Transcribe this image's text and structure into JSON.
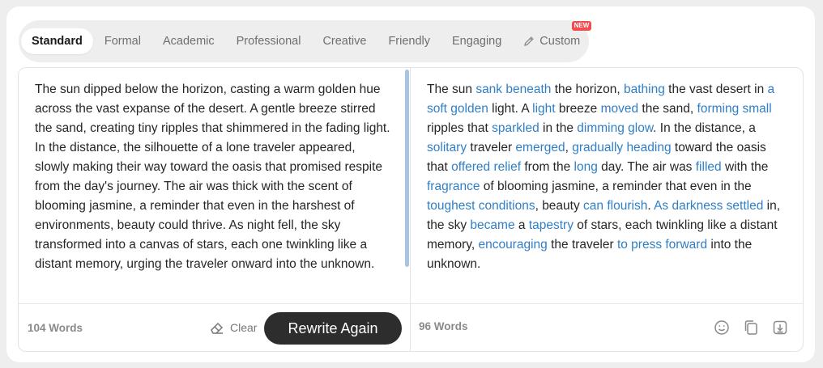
{
  "modes": [
    {
      "label": "Standard",
      "active": true
    },
    {
      "label": "Formal"
    },
    {
      "label": "Academic"
    },
    {
      "label": "Professional"
    },
    {
      "label": "Creative"
    },
    {
      "label": "Friendly"
    },
    {
      "label": "Engaging"
    },
    {
      "label": "Custom",
      "badge": "NEW"
    }
  ],
  "original": {
    "text": "The sun dipped below the horizon, casting a warm golden hue across the vast expanse of the desert. A gentle breeze stirred the sand, creating tiny ripples that shimmered in the fading light. In the distance, the silhouette of a lone traveler appeared, slowly making their way toward the oasis that promised respite from the day's journey. The air was thick with the scent of blooming jasmine, a reminder that even in the harshest of environments, beauty could thrive. As night fell, the sky transformed into a canvas of stars, each one twinkling like a distant memory, urging the traveler onward into the unknown.",
    "word_count": "104 Words",
    "clear_label": "Clear",
    "rewrite_label": "Rewrite Again"
  },
  "rewritten": {
    "segments": [
      {
        "t": "The sun "
      },
      {
        "t": "sank beneath",
        "hl": true
      },
      {
        "t": " the horizon, "
      },
      {
        "t": "bathing",
        "hl": true
      },
      {
        "t": " the vast desert in "
      },
      {
        "t": "a soft golden",
        "hl": true
      },
      {
        "t": " light. A "
      },
      {
        "t": "light",
        "hl": true
      },
      {
        "t": " breeze "
      },
      {
        "t": "moved",
        "hl": true
      },
      {
        "t": " the sand, "
      },
      {
        "t": "forming small",
        "hl": true
      },
      {
        "t": " ripples that "
      },
      {
        "t": "sparkled",
        "hl": true
      },
      {
        "t": " in the "
      },
      {
        "t": "dimming glow",
        "hl": true
      },
      {
        "t": ". In the distance, a "
      },
      {
        "t": "solitary",
        "hl": true
      },
      {
        "t": " traveler "
      },
      {
        "t": "emerged",
        "hl": true
      },
      {
        "t": ", "
      },
      {
        "t": "gradually heading",
        "hl": true
      },
      {
        "t": " toward the oasis that "
      },
      {
        "t": "offered relief",
        "hl": true
      },
      {
        "t": " from the "
      },
      {
        "t": "long",
        "hl": true
      },
      {
        "t": " day. The air was "
      },
      {
        "t": "filled",
        "hl": true
      },
      {
        "t": " with the "
      },
      {
        "t": "fragrance",
        "hl": true
      },
      {
        "t": " of blooming jasmine, a reminder that even in the "
      },
      {
        "t": "toughest conditions",
        "hl": true
      },
      {
        "t": ", beauty "
      },
      {
        "t": "can flourish",
        "hl": true
      },
      {
        "t": ". "
      },
      {
        "t": "As darkness settled",
        "hl": true
      },
      {
        "t": " in, the sky "
      },
      {
        "t": "became",
        "hl": true
      },
      {
        "t": " a "
      },
      {
        "t": "tapestry",
        "hl": true
      },
      {
        "t": " of stars, each twinkling like a distant memory, "
      },
      {
        "t": "encouraging",
        "hl": true
      },
      {
        "t": " the traveler "
      },
      {
        "t": "to press forward",
        "hl": true
      },
      {
        "t": " into the unknown."
      }
    ],
    "word_count": "96 Words",
    "tools": [
      "smiley-icon",
      "copy-icon",
      "download-icon"
    ]
  },
  "colors": {
    "highlight": "#2f7fc7",
    "button_dark": "#2d2d2d",
    "new_badge": "#f24c4c"
  }
}
